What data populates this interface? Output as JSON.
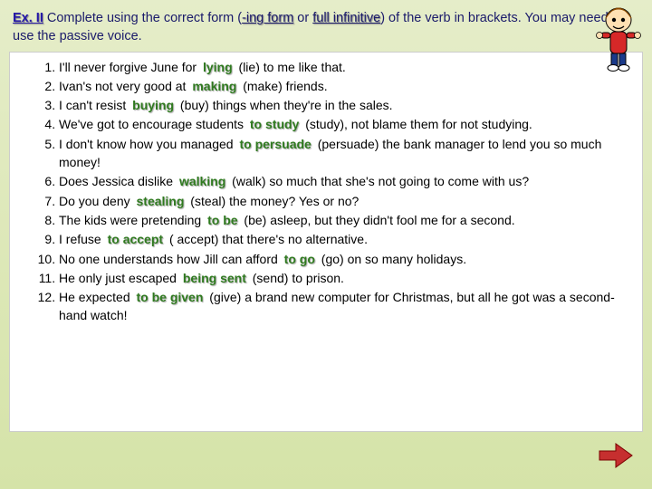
{
  "instruction": {
    "ex_label": "Ex. II",
    "part1": "  Complete using the correct form (",
    "ing_form": "-ing form",
    "or_text": " or ",
    "full_inf": "full infinitive",
    "part2": ") of the verb in brackets. You may need to use the passive voice."
  },
  "items": [
    {
      "pre": "I'll never forgive June for   ",
      "ans": "lying",
      "post": "  (lie) to me like that."
    },
    {
      "pre": "Ivan's not very good at   ",
      "ans": "making",
      "post": "     (make) friends."
    },
    {
      "pre": "I can't resist      ",
      "ans": "buying",
      "post": "    (buy) things when they're in the sales."
    },
    {
      "pre": "We've got to encourage students  ",
      "ans": "to study",
      "post": "    (study), not blame them for not studying."
    },
    {
      "pre": "I don't know how you managed  ",
      "ans": "to persuade",
      "post": "   (persuade) the bank manager to lend you so much money!"
    },
    {
      "pre": "Does Jessica dislike    ",
      "ans": "walking",
      "post": "   (walk) so much that she's not going to come with us?"
    },
    {
      "pre": "Do you deny  ",
      "ans": "stealing",
      "post": "    (steal) the money? Yes or no?"
    },
    {
      "pre": "The kids were  pretending  ",
      "ans": "to be",
      "post": "   (be) asleep, but they didn't fool me for a second."
    },
    {
      "pre": "I refuse   ",
      "ans": "to accept",
      "post": " ( accept) that there's no alternative."
    },
    {
      "pre": "No one understands how Jill can afford     ",
      "ans": "to go",
      "post": "   (go) on so many holidays."
    },
    {
      "pre": "He only just escaped    ",
      "ans": "being sent",
      "post": "    (send) to prison."
    },
    {
      "pre": "He expected      ",
      "ans": "to be given",
      "post": "        (give) a brand new computer for Christmas, but all he got was a second-hand watch!"
    }
  ]
}
